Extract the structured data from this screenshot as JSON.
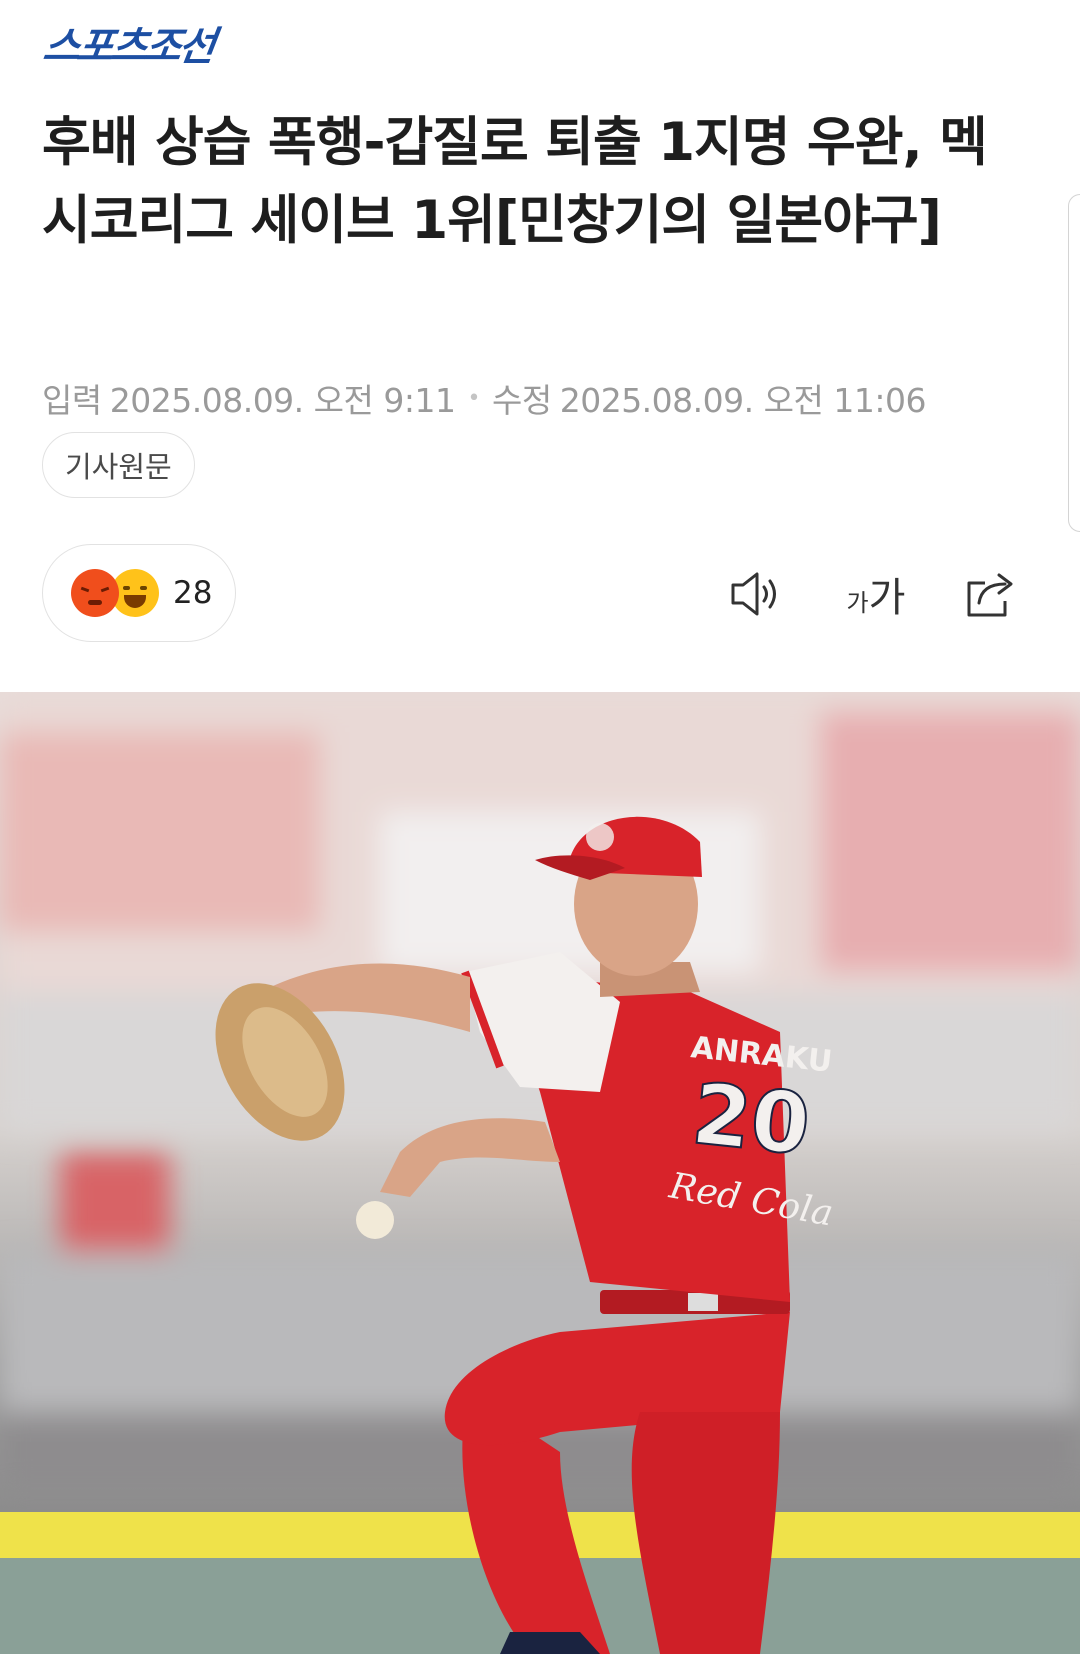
{
  "header": {
    "logo_text": "스포츠조선",
    "brand_color": "#1d4fa3"
  },
  "article": {
    "title": "후배 상습 폭행-갑질로 퇴출 1지명 우완, 멕시코리그 세이브 1위[민창기의 일본야구]",
    "published_label": "입력",
    "published_time": "2025.08.09. 오전 9:11",
    "modified_label": "수정",
    "modified_time": "2025.08.09. 오전 11:06",
    "original_article_label": "기사원문"
  },
  "reactions": {
    "emojis": [
      "angry-emoji-icon",
      "laughing-emoji-icon"
    ],
    "count": "28"
  },
  "toolbar": {
    "speaker_icon": "speaker-icon",
    "font_size_icon": "font-size-icon",
    "font_size_small": "가",
    "font_size_big": "가",
    "share_icon": "share-icon"
  },
  "photo": {
    "jersey_name": "ANRAKU",
    "jersey_number": "20",
    "jersey_sponsor": "Red Cola",
    "team_color": "#d8232a"
  }
}
